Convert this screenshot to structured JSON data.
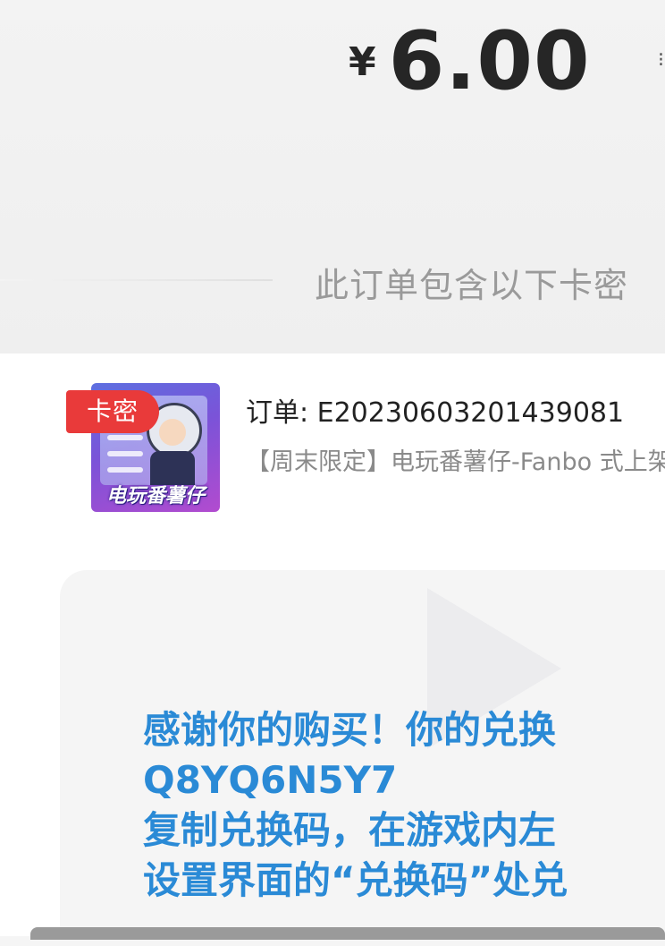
{
  "payment": {
    "currency_symbol": "¥",
    "amount": "6.00"
  },
  "section": {
    "label": "此订单包含以下卡密"
  },
  "order": {
    "tag_label": "卡密",
    "order_label": "订单: E20230603201439081",
    "product_name": "【周末限定】电玩番薯仔-Fanbo 式上架)",
    "thumbnail_title": "电玩番薯仔"
  },
  "redeem": {
    "line1": "感谢你的购买！你的兑换",
    "line2": "Q8YQ6N5Y7",
    "line3": "复制兑换码，在游戏内左",
    "line4": "设置界面的“兑换码”处兑"
  },
  "colors": {
    "accent_blue": "#2a8ad6",
    "tag_red": "#e93a3a",
    "muted_text": "#9a9a9a"
  }
}
